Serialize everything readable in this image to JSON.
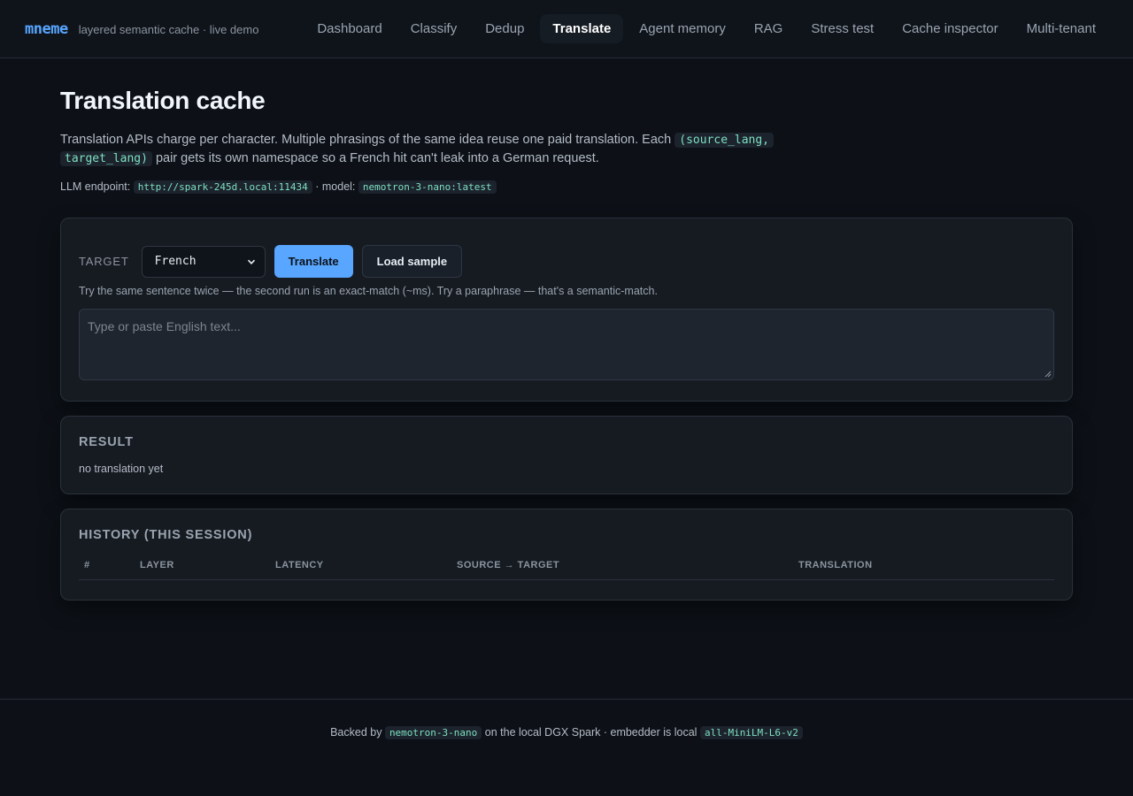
{
  "brand": {
    "logo": "mneme",
    "tagline": "layered semantic cache · live demo"
  },
  "nav": {
    "items": [
      "Dashboard",
      "Classify",
      "Dedup",
      "Translate",
      "Agent memory",
      "RAG",
      "Stress test",
      "Cache inspector",
      "Multi-tenant"
    ],
    "active": "Translate"
  },
  "page": {
    "title": "Translation cache",
    "desc_part1": "Translation APIs charge per character. Multiple phrasings of the same idea reuse one paid translation. Each ",
    "desc_code1": "(source_lang,",
    "desc_code2": "target_lang)",
    "desc_part2": " pair gets its own namespace so a French hit can't leak into a German request.",
    "endpoint_label": "LLM endpoint:",
    "endpoint_url": "http://spark-245d.local:11434",
    "model_label": " · model:",
    "model_name": "nemotron-3-nano:latest"
  },
  "form": {
    "target_label": "TARGET",
    "target_value": "French",
    "translate_button": "Translate",
    "sample_button": "Load sample",
    "hint": "Try the same sentence twice — the second run is an exact-match (~ms). Try a paraphrase — that's a semantic-match.",
    "input_placeholder": "Type or paste English text..."
  },
  "result": {
    "title": "RESULT",
    "text": "no translation yet"
  },
  "history": {
    "title": "HISTORY (THIS SESSION)",
    "columns": [
      "#",
      "LAYER",
      "LATENCY",
      "SOURCE → TARGET",
      "TRANSLATION"
    ]
  },
  "footer": {
    "prefix": "Backed by",
    "model": "nemotron-3-nano",
    "middle": "on the local DGX Spark · embedder is local",
    "embedder": "all-MiniLM-L6-v2"
  },
  "colors": {
    "background": "#0d1117",
    "accent": "#58a6ff",
    "code": "#7ee0c3",
    "card": "#161b22"
  }
}
